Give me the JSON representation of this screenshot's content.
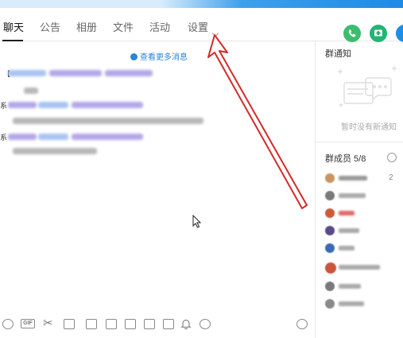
{
  "header": {
    "tabs": [
      {
        "label": "聊天",
        "active": true
      },
      {
        "label": "公告"
      },
      {
        "label": "相册"
      },
      {
        "label": "文件"
      },
      {
        "label": "活动"
      },
      {
        "label": "设置"
      }
    ]
  },
  "chat": {
    "history_link": "查看更多消息",
    "msg_badge": "【",
    "sys_prefix_1": "系",
    "sys_prefix_2": "系"
  },
  "sidebar": {
    "notice_title": "群通知",
    "notice_empty": "暂时没有新通知",
    "members_title": "群成员 5/8",
    "members_count": "2"
  },
  "colors": {
    "accent_blue": "#1e8de6",
    "link_blue": "#2b84d8",
    "annotation_red": "#d42a2a"
  },
  "icons": {
    "toolbar": [
      "emoji-icon",
      "gif-icon",
      "scissors-icon",
      "folder-icon",
      "screenshot-icon",
      "image-icon",
      "bag-icon",
      "gift-icon",
      "vote-icon",
      "bell-icon",
      "more-icon",
      "clock-icon"
    ]
  }
}
